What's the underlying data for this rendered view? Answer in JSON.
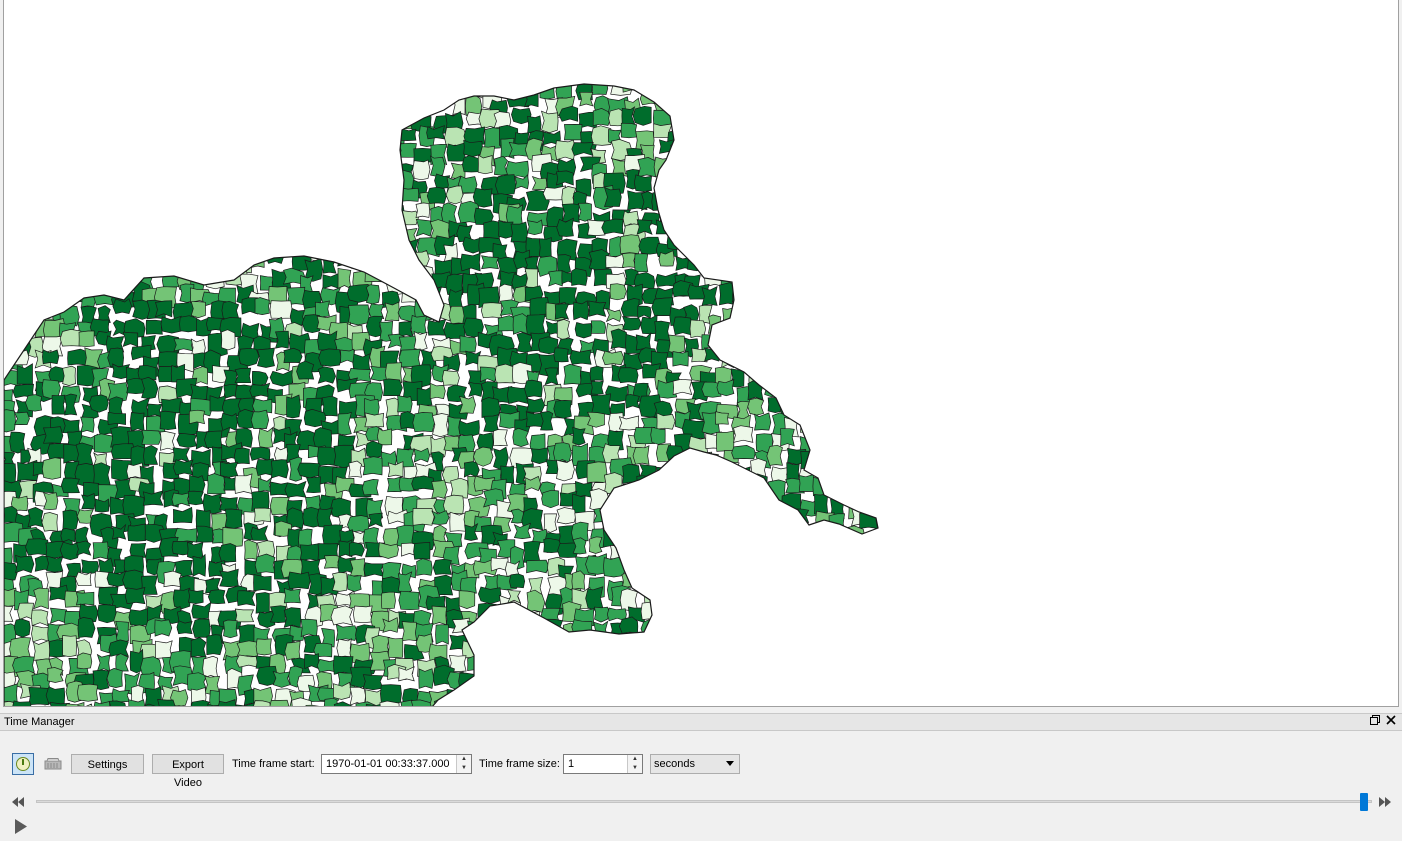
{
  "map": {
    "colors": {
      "darkest": "#006d2c",
      "dark": "#31a354",
      "mid": "#74c476",
      "light": "#bae4b3",
      "lightest": "#edf8e9",
      "outline": "#1a1a1a"
    }
  },
  "dock": {
    "title": "Time Manager",
    "restore_icon": "restore-icon",
    "close_icon": "close-icon"
  },
  "toolbar": {
    "power_icon": "power-icon",
    "archive_icon": "archive-icon",
    "settings_label": "Settings",
    "export_label": "Export Video",
    "time_start_label": "Time frame start:",
    "time_start_value": "1970-01-01 00:33:37.000",
    "time_size_label": "Time frame size:",
    "time_size_value": "1",
    "time_unit_value": "seconds"
  },
  "timeline": {
    "rewind_icon": "rewind-icon",
    "forward_icon": "fast-forward-icon",
    "play_icon": "play-icon",
    "position_fraction": 0.996
  },
  "colors": {
    "accent": "#0078d7",
    "window_bg": "#f0f0f0",
    "map_bg": "#ffffff"
  }
}
